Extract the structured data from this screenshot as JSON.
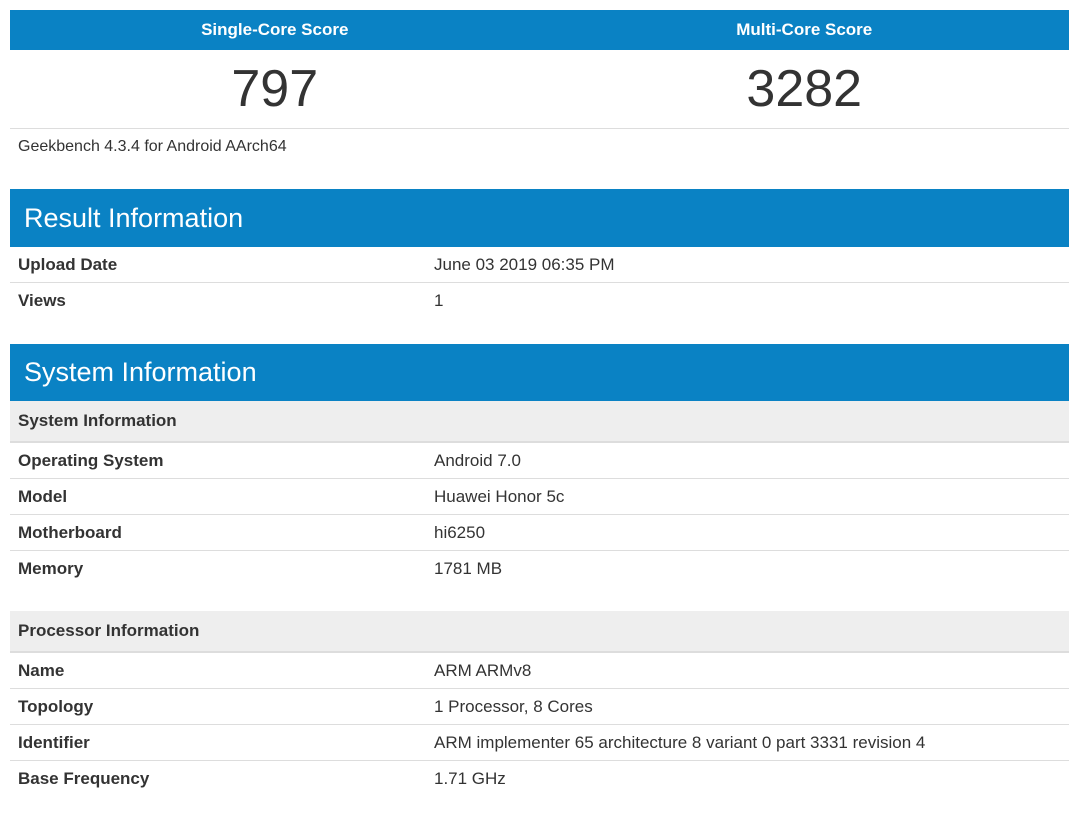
{
  "scores": {
    "single_label": "Single-Core Score",
    "multi_label": "Multi-Core Score",
    "single_value": "797",
    "multi_value": "3282",
    "version": "Geekbench 4.3.4 for Android AArch64"
  },
  "result_info": {
    "title": "Result Information",
    "rows": [
      {
        "key": "Upload Date",
        "value": "June 03 2019 06:35 PM"
      },
      {
        "key": "Views",
        "value": "1"
      }
    ]
  },
  "system_info": {
    "title": "System Information",
    "subtitle": "System Information",
    "rows": [
      {
        "key": "Operating System",
        "value": "Android 7.0"
      },
      {
        "key": "Model",
        "value": "Huawei Honor 5c"
      },
      {
        "key": "Motherboard",
        "value": "hi6250"
      },
      {
        "key": "Memory",
        "value": "1781 MB"
      }
    ]
  },
  "processor_info": {
    "subtitle": "Processor Information",
    "rows": [
      {
        "key": "Name",
        "value": "ARM ARMv8"
      },
      {
        "key": "Topology",
        "value": "1 Processor, 8 Cores"
      },
      {
        "key": "Identifier",
        "value": "ARM implementer 65 architecture 8 variant 0 part 3331 revision 4"
      },
      {
        "key": "Base Frequency",
        "value": "1.71 GHz"
      }
    ]
  },
  "colors": {
    "header_blue": "#0a82c4",
    "subheader_gray": "#eeeeee",
    "text": "#333333"
  }
}
